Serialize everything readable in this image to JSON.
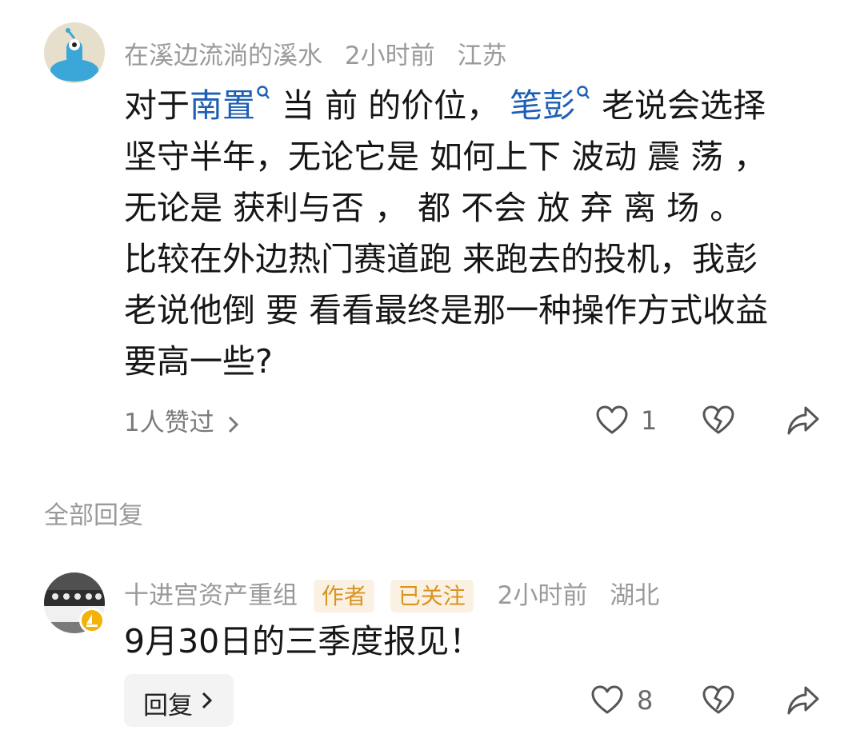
{
  "comment": {
    "username": "在溪边流淌的溪水",
    "time": "2小时前",
    "location": "江苏",
    "lines": [
      [
        {
          "t": "对于",
          "link": false
        },
        {
          "t": "南置",
          "link": true
        },
        {
          "t": " 当 前 的价位， ",
          "link": false
        },
        {
          "t": "笔彭",
          "link": true
        },
        {
          "t": " 老说会选择",
          "link": false
        }
      ],
      [
        {
          "t": "坚守半年，无论它是 如何上下 波动 震 荡 ，",
          "link": false
        }
      ],
      [
        {
          "t": "无论是 获利与否 ， 都 不会 放 弃 离 场 。",
          "link": false
        }
      ],
      [
        {
          "t": "比较在外边热门赛道跑 来跑去的投机，我彭",
          "link": false
        }
      ],
      [
        {
          "t": "老说他倒 要 看看最终是那一种操作方式收益",
          "link": false
        }
      ],
      [
        {
          "t": "要高一些?",
          "link": false
        }
      ]
    ],
    "likes_summary": "1人赞过",
    "like_count": "1"
  },
  "section_title": "全部回复",
  "reply": {
    "username": "十进宫资产重组",
    "author_tag": "作者",
    "follow_tag": "已关注",
    "time": "2小时前",
    "location": "湖北",
    "text": "9月30日的三季度报见！",
    "reply_button": "回复",
    "like_count": "8"
  },
  "icons": [
    "chevron-right-icon",
    "heart-icon",
    "broken-heart-icon",
    "share-icon",
    "search-icon"
  ],
  "colors": {
    "link": "#1d5fb5",
    "meta": "#9a9a9a",
    "tag_text": "#d9941f",
    "tag_bg": "#fbf1e3"
  }
}
